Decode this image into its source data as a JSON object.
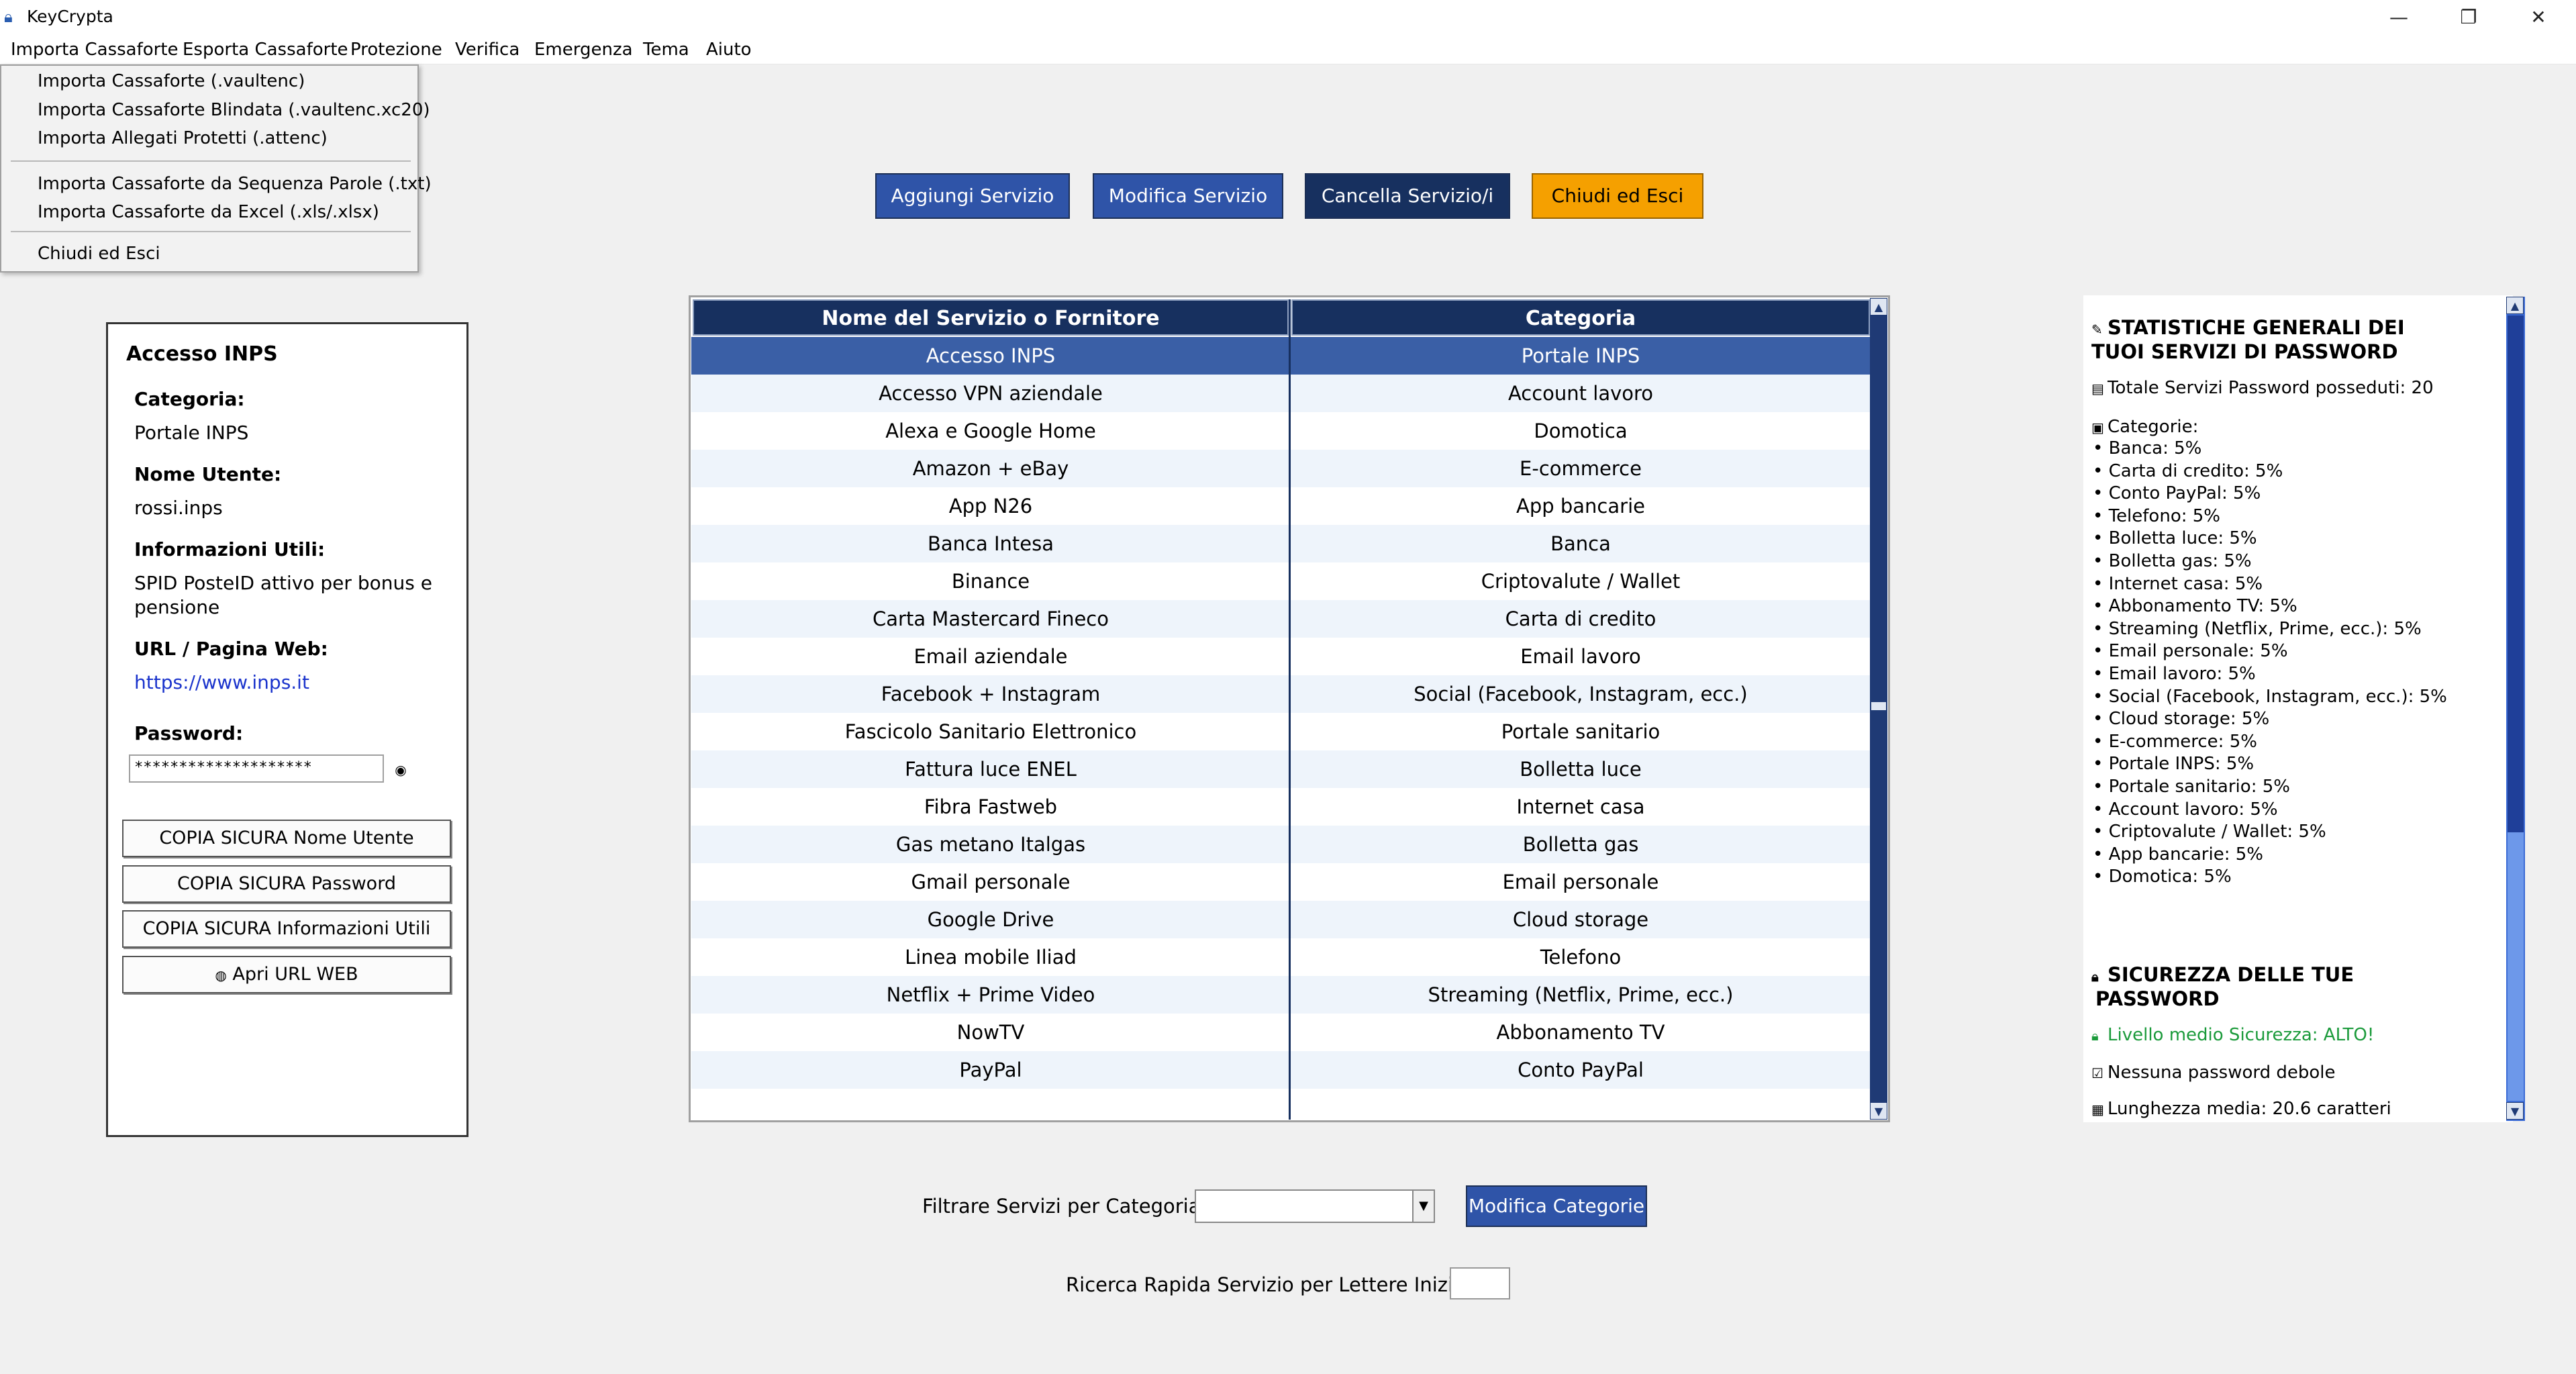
{
  "window": {
    "title": "KeyCrypta",
    "controls": [
      "—",
      "❐",
      "✕"
    ]
  },
  "menubar": [
    "Importa Cassaforte",
    "Esporta Cassaforte",
    "Protezione",
    "Verifica",
    "Emergenza",
    "Tema",
    "Aiuto"
  ],
  "dropdown": {
    "items": [
      "Importa Cassaforte (.vaultenc)",
      "Importa Cassaforte Blindata (.vaultenc.xc20)",
      "Importa Allegati Protetti (.attenc)",
      "Importa Cassaforte da Sequenza Parole (.txt)",
      "Importa Cassaforte da Excel (.xls/.xlsx)",
      "Chiudi ed Esci"
    ]
  },
  "toolbar": {
    "add": "Aggiungi Servizio",
    "edit": "Modifica Servizio",
    "delete": "Cancella Servizio/i",
    "close": "Chiudi ed Esci"
  },
  "detail": {
    "title": "Accesso INPS",
    "category_label": "Categoria:",
    "category_value": "Portale INPS",
    "username_label": "Nome Utente:",
    "username_value": "rossi.inps",
    "info_label": "Informazioni Utili:",
    "info_value_1": "SPID PosteID attivo per bonus e",
    "info_value_2": "pensione",
    "url_label": "URL / Pagina Web:",
    "url_value": "https://www.inps.it",
    "password_label": "Password:",
    "password_value": "********************",
    "copy_username": "COPIA SICURA Nome Utente",
    "copy_password": "COPIA SICURA Password",
    "copy_info": "COPIA SICURA Informazioni Utili",
    "open_url": "Apri URL WEB",
    "colors": {
      "link": "#1a33cc"
    }
  },
  "table": {
    "headers": [
      "Nome del Servizio o Fornitore",
      "Categoria"
    ],
    "selected_index": 0,
    "rows": [
      [
        "Accesso INPS",
        "Portale INPS"
      ],
      [
        "Accesso VPN aziendale",
        "Account lavoro"
      ],
      [
        "Alexa e Google Home",
        "Domotica"
      ],
      [
        "Amazon + eBay",
        "E-commerce"
      ],
      [
        "App N26",
        "App bancarie"
      ],
      [
        "Banca Intesa",
        "Banca"
      ],
      [
        "Binance",
        "Criptovalute / Wallet"
      ],
      [
        "Carta Mastercard Fineco",
        "Carta di credito"
      ],
      [
        "Email aziendale",
        "Email lavoro"
      ],
      [
        "Facebook + Instagram",
        "Social (Facebook, Instagram, ecc.)"
      ],
      [
        "Fascicolo Sanitario Elettronico",
        "Portale sanitario"
      ],
      [
        "Fattura luce ENEL",
        "Bolletta luce"
      ],
      [
        "Fibra Fastweb",
        "Internet casa"
      ],
      [
        "Gas metano Italgas",
        "Bolletta gas"
      ],
      [
        "Gmail personale",
        "Email personale"
      ],
      [
        "Google Drive",
        "Cloud storage"
      ],
      [
        "Linea mobile Iliad",
        "Telefono"
      ],
      [
        "Netflix + Prime Video",
        "Streaming (Netflix, Prime, ecc.)"
      ],
      [
        "NowTV",
        "Abbonamento TV"
      ],
      [
        "PayPal",
        "Conto PayPal"
      ]
    ]
  },
  "filter": {
    "label": "Filtrare Servizi per Categoria:",
    "value": "",
    "button": "Modifica Categorie",
    "quick_label": "Ricerca Rapida Servizio per Lettere Iniziali:",
    "quick_value": ""
  },
  "stats": {
    "title_line1": "STATISTICHE GENERALI DEI",
    "title_line2": "TUOI SERVIZI DI PASSWORD",
    "total": "Totale Servizi Password posseduti: 20",
    "categories_label": "Categorie:",
    "categories": [
      "• Banca: 5%",
      "• Carta di credito: 5%",
      "• Conto PayPal: 5%",
      "• Telefono: 5%",
      "• Bolletta luce: 5%",
      "• Bolletta gas: 5%",
      "• Internet casa: 5%",
      "• Abbonamento TV: 5%",
      "• Streaming (Netflix, Prime, ecc.): 5%",
      "• Email personale: 5%",
      "• Email lavoro: 5%",
      "• Social (Facebook, Instagram, ecc.): 5%",
      "• Cloud storage: 5%",
      "• E-commerce: 5%",
      "• Portale INPS: 5%",
      "• Portale sanitario: 5%",
      "• Account lavoro: 5%",
      "• Criptovalute / Wallet: 5%",
      "• App bancarie: 5%",
      "• Domotica: 5%"
    ],
    "security_line1": "SICUREZZA DELLE TUE",
    "security_line2": "PASSWORD",
    "level": "Livello medio Sicurezza: ALTO!",
    "weak": "Nessuna password debole",
    "avg_length": "Lunghezza media: 20.6 caratteri",
    "colors": {
      "level": "#1a9a3a"
    }
  },
  "colors": {
    "btn_blue": "#2f54a8",
    "btn_navy": "#17305f",
    "btn_orange": "#f5a000",
    "header_navy": "#17305f",
    "selected_row": "#3a5fa6"
  }
}
